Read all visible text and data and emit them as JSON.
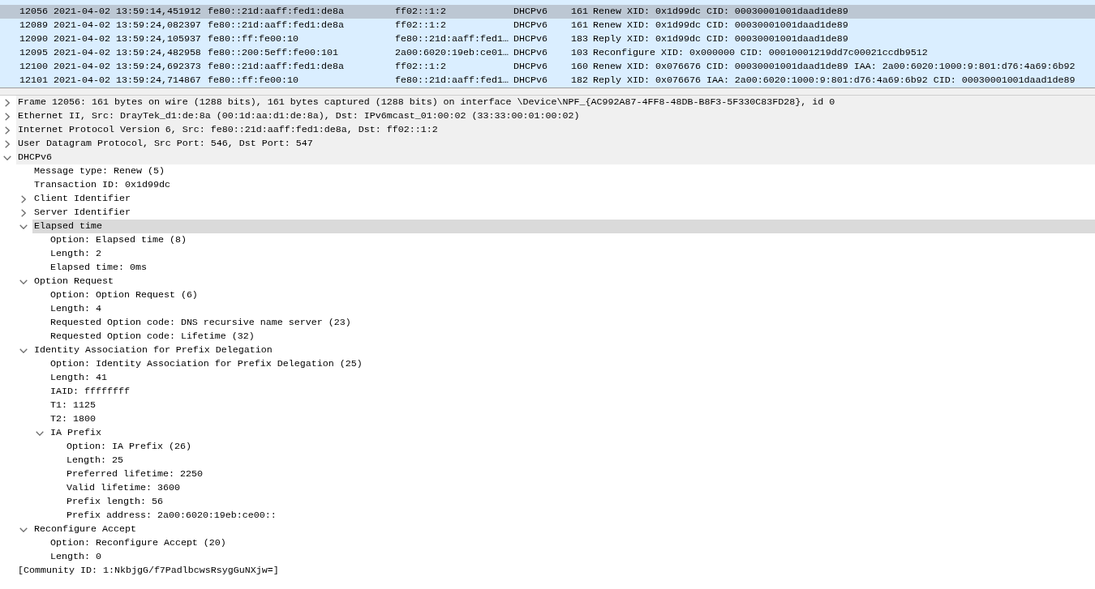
{
  "packet_list": {
    "rows": [
      {
        "no": "12056",
        "time": "2021-04-02 13:59:14,451912",
        "source": "fe80::21d:aaff:fed1:de8a",
        "destination": "ff02::1:2",
        "protocol": "DHCPv6",
        "length": "161",
        "info": "Renew XID: 0x1d99dc CID: 00030001001daad1de89",
        "selected": true
      },
      {
        "no": "12089",
        "time": "2021-04-02 13:59:24,082397",
        "source": "fe80::21d:aaff:fed1:de8a",
        "destination": "ff02::1:2",
        "protocol": "DHCPv6",
        "length": "161",
        "info": "Renew XID: 0x1d99dc CID: 00030001001daad1de89",
        "selected": false
      },
      {
        "no": "12090",
        "time": "2021-04-02 13:59:24,105937",
        "source": "fe80::ff:fe00:10",
        "destination": "fe80::21d:aaff:fed1…",
        "protocol": "DHCPv6",
        "length": "183",
        "info": "Reply XID: 0x1d99dc CID: 00030001001daad1de89",
        "selected": false
      },
      {
        "no": "12095",
        "time": "2021-04-02 13:59:24,482958",
        "source": "fe80::200:5eff:fe00:101",
        "destination": "2a00:6020:19eb:ce01…",
        "protocol": "DHCPv6",
        "length": "103",
        "info": "Reconfigure XID: 0x000000 CID: 00010001219dd7c00021ccdb9512",
        "selected": false
      },
      {
        "no": "12100",
        "time": "2021-04-02 13:59:24,692373",
        "source": "fe80::21d:aaff:fed1:de8a",
        "destination": "ff02::1:2",
        "protocol": "DHCPv6",
        "length": "160",
        "info": "Renew XID: 0x076676 CID: 00030001001daad1de89 IAA: 2a00:6020:1000:9:801:d76:4a69:6b92",
        "selected": false
      },
      {
        "no": "12101",
        "time": "2021-04-02 13:59:24,714867",
        "source": "fe80::ff:fe00:10",
        "destination": "fe80::21d:aaff:fed1…",
        "protocol": "DHCPv6",
        "length": "182",
        "info": "Reply XID: 0x076676 IAA: 2a00:6020:1000:9:801:d76:4a69:6b92 CID: 00030001001daad1de89",
        "selected": false
      }
    ]
  },
  "packet_details": {
    "items": [
      {
        "text": "Frame 12056: 161 bytes on wire (1288 bits), 161 bytes captured (1288 bits) on interface \\Device\\NPF_{AC992A87-4FF8-48DB-B8F3-5F330C83FD28}, id 0",
        "kind": "protocol",
        "expanded": false,
        "selected": false
      },
      {
        "text": "Ethernet II, Src: DrayTek_d1:de:8a (00:1d:aa:d1:de:8a), Dst: IPv6mcast_01:00:02 (33:33:00:01:00:02)",
        "kind": "protocol",
        "expanded": false,
        "selected": false
      },
      {
        "text": "Internet Protocol Version 6, Src: fe80::21d:aaff:fed1:de8a, Dst: ff02::1:2",
        "kind": "protocol",
        "expanded": false,
        "selected": false
      },
      {
        "text": "User Datagram Protocol, Src Port: 546, Dst Port: 547",
        "kind": "protocol",
        "expanded": false,
        "selected": false
      },
      {
        "text": "DHCPv6",
        "kind": "protocol",
        "expanded": true,
        "selected": false,
        "children": [
          {
            "text": "Message type: Renew (5)",
            "selected": false
          },
          {
            "text": "Transaction ID: 0x1d99dc",
            "selected": false
          },
          {
            "text": "Client Identifier",
            "expanded": false,
            "selected": false
          },
          {
            "text": "Server Identifier",
            "expanded": false,
            "selected": false
          },
          {
            "text": "Elapsed time",
            "expanded": true,
            "selected": true,
            "children": [
              {
                "text": "Option: Elapsed time (8)",
                "selected": false
              },
              {
                "text": "Length: 2",
                "selected": false
              },
              {
                "text": "Elapsed time: 0ms",
                "selected": false
              }
            ]
          },
          {
            "text": "Option Request",
            "expanded": true,
            "selected": false,
            "children": [
              {
                "text": "Option: Option Request (6)",
                "selected": false
              },
              {
                "text": "Length: 4",
                "selected": false
              },
              {
                "text": "Requested Option code: DNS recursive name server (23)",
                "selected": false
              },
              {
                "text": "Requested Option code: Lifetime (32)",
                "selected": false
              }
            ]
          },
          {
            "text": "Identity Association for Prefix Delegation",
            "expanded": true,
            "selected": false,
            "children": [
              {
                "text": "Option: Identity Association for Prefix Delegation (25)",
                "selected": false
              },
              {
                "text": "Length: 41",
                "selected": false
              },
              {
                "text": "IAID: ffffffff",
                "selected": false
              },
              {
                "text": "T1: 1125",
                "selected": false
              },
              {
                "text": "T2: 1800",
                "selected": false
              },
              {
                "text": "IA Prefix",
                "expanded": true,
                "selected": false,
                "children": [
                  {
                    "text": "Option: IA Prefix (26)",
                    "selected": false
                  },
                  {
                    "text": "Length: 25",
                    "selected": false
                  },
                  {
                    "text": "Preferred lifetime: 2250",
                    "selected": false
                  },
                  {
                    "text": "Valid lifetime: 3600",
                    "selected": false
                  },
                  {
                    "text": "Prefix length: 56",
                    "selected": false
                  },
                  {
                    "text": "Prefix address: 2a00:6020:19eb:ce00::",
                    "selected": false
                  }
                ]
              }
            ]
          },
          {
            "text": "Reconfigure Accept",
            "expanded": true,
            "selected": false,
            "children": [
              {
                "text": "Option: Reconfigure Accept (20)",
                "selected": false
              },
              {
                "text": "Length: 0",
                "selected": false
              }
            ]
          }
        ]
      },
      {
        "text": "[Community ID: 1:NkbjgG/f7PadlbcwsRsygGuNXjw=]",
        "kind": "field",
        "selected": false
      }
    ]
  }
}
